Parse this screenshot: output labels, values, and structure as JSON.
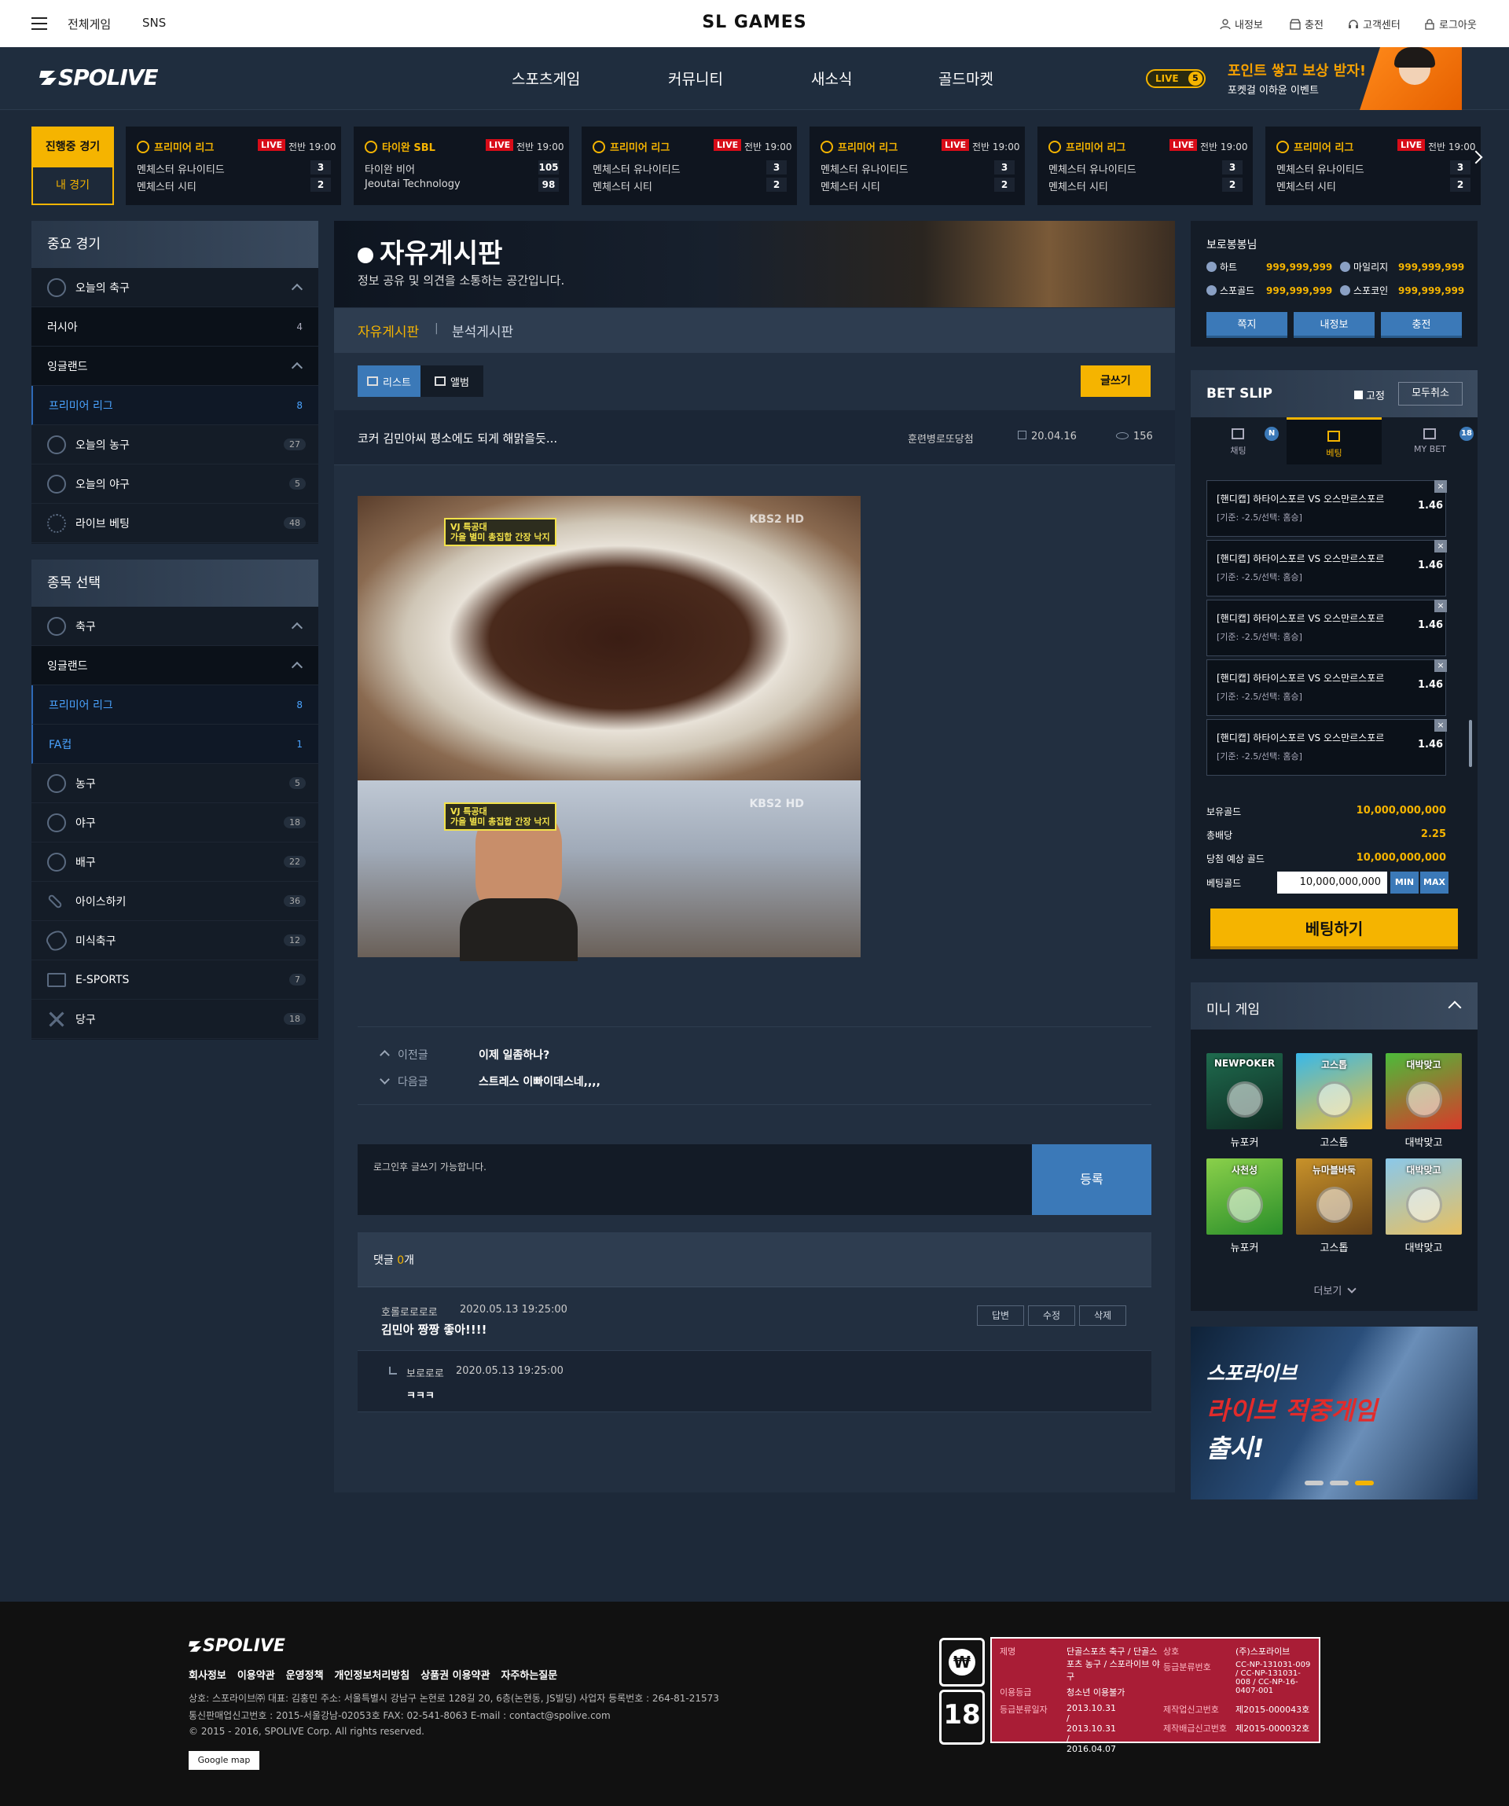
{
  "topbar": {
    "menu_all": "전체게임",
    "menu_sns": "SNS",
    "logo": "SL GAMES",
    "myinfo": "내정보",
    "charge": "충전",
    "support": "고객센터",
    "logout": "로그아웃"
  },
  "nav": {
    "brand": "SPOLIVE",
    "items": [
      "스포츠게임",
      "커뮤니티",
      "새소식",
      "골드마켓"
    ],
    "live_badge": "LIVE",
    "live_count": "5",
    "promo_title": "포인트 쌓고 보상 받자!",
    "promo_sub": "포켓걸 이하윤 이벤트"
  },
  "matches": {
    "tab_live": "진행중 경기",
    "tab_mine": "내 경기",
    "cards": [
      {
        "league": "프리미어 리그",
        "live": "LIVE",
        "time": "전반 19:00",
        "team1": "멘체스터 유나이티드",
        "team2": "멘체스터 시티",
        "score1": "3",
        "score2": "2"
      },
      {
        "league": "타이완 SBL",
        "live": "LIVE",
        "time": "전반 19:00",
        "team1": "타이완 비어",
        "team2": "Jeoutai Technology",
        "score1": "105",
        "score2": "98"
      },
      {
        "league": "프리미어 리그",
        "live": "LIVE",
        "time": "전반 19:00",
        "team1": "멘체스터 유나이티드",
        "team2": "멘체스터 시티",
        "score1": "3",
        "score2": "2"
      },
      {
        "league": "프리미어 리그",
        "live": "LIVE",
        "time": "전반 19:00",
        "team1": "멘체스터 유나이티드",
        "team2": "멘체스터 시티",
        "score1": "3",
        "score2": "2"
      },
      {
        "league": "프리미어 리그",
        "live": "LIVE",
        "time": "전반 19:00",
        "team1": "멘체스터 유나이티드",
        "team2": "멘체스터 시티",
        "score1": "3",
        "score2": "2"
      },
      {
        "league": "프리미어 리그",
        "live": "LIVE",
        "time": "전반 19:00",
        "team1": "멘체스터 유나이티드",
        "team2": "멘체스터 시티",
        "score1": "3",
        "score2": "2"
      }
    ]
  },
  "important": {
    "title": "중요 경기",
    "rows": [
      {
        "label": "오늘의 축구",
        "count": ""
      },
      {
        "label": "러시아",
        "count": "4"
      },
      {
        "label": "잉글랜드",
        "count": ""
      },
      {
        "label": "프리미어 리그",
        "count": "8"
      },
      {
        "label": "오늘의 농구",
        "count": "27"
      },
      {
        "label": "오늘의 야구",
        "count": "5"
      },
      {
        "label": "라이브 베팅",
        "count": "48"
      }
    ]
  },
  "sports": {
    "title": "종목 선택",
    "rows": [
      {
        "label": "축구",
        "count": ""
      },
      {
        "label": "잉글랜드",
        "count": ""
      },
      {
        "label": "프리미어 리그",
        "count": "8"
      },
      {
        "label": "FA컵",
        "count": "1"
      },
      {
        "label": "농구",
        "count": "5"
      },
      {
        "label": "야구",
        "count": "18"
      },
      {
        "label": "배구",
        "count": "22"
      },
      {
        "label": "아이스하키",
        "count": "36"
      },
      {
        "label": "미식축구",
        "count": "12"
      },
      {
        "label": "E-SPORTS",
        "count": "7"
      },
      {
        "label": "당구",
        "count": "18"
      }
    ]
  },
  "board": {
    "title": "자유게시판",
    "subtitle": "정보 공유 및 의견을 소통하는 공간입니다.",
    "tab_free": "자유게시판",
    "tab_analysis": "분석게시판",
    "view_list": "리스트",
    "view_album": "앨범",
    "write": "글쓰기",
    "post": {
      "title": "코커 김민아씨 평소에도 되게 해맑을듯...",
      "author": "훈련병로또당첨",
      "date": "20.04.16",
      "views": "156"
    },
    "image_caption1": "VJ 특공대",
    "image_caption2": "가을 별미 총집합 간장 낙지",
    "watermark": "KBS2 HD",
    "prev_label": "이전글",
    "prev_title": "이제 일좀하나?",
    "next_label": "다음글",
    "next_title": "스트레스 이빠이데스네,,,,",
    "comment_placeholder": "로그인후 글쓰기 가능합니다.",
    "register": "등록",
    "comments_label": "댓글",
    "comments_count": "0",
    "comments_unit": "개",
    "comment": {
      "author": "호롤로로로로",
      "date": "2020.05.13  19:25:00",
      "text": "김민아 짱짱 좋아!!!!",
      "reply_btn": "답변",
      "edit_btn": "수정",
      "delete_btn": "삭제"
    },
    "reply": {
      "author": "보로로로",
      "date": "2020.05.13  19:25:00",
      "text": "ㅋㅋㅋ"
    }
  },
  "user": {
    "name": "보로봉봉님",
    "heart_label": "하트",
    "heart": "999,999,999",
    "mileage_label": "마일리지",
    "mileage": "999,999,999",
    "gold_label": "스포골드",
    "gold": "999,999,999",
    "coin_label": "스포코인",
    "coin": "999,999,999",
    "btn_note": "쪽지",
    "btn_info": "내정보",
    "btn_charge": "충전"
  },
  "betslip": {
    "title": "BET SLIP",
    "fix": "고정",
    "cancel_all": "모두취소",
    "tab_chat": "채팅",
    "tab_chat_badge": "N",
    "tab_bet": "베팅",
    "tab_mybet": "MY BET",
    "tab_mybet_badge": "18",
    "items": [
      {
        "name": "[핸디캡] 하타이스포르 VS 오스만르스포르",
        "sub": "[기준: -2.5/선택: 홈승]",
        "odds": "1.46"
      },
      {
        "name": "[핸디캡] 하타이스포르 VS 오스만르스포르",
        "sub": "[기준: -2.5/선택: 홈승]",
        "odds": "1.46"
      },
      {
        "name": "[핸디캡] 하타이스포르 VS 오스만르스포르",
        "sub": "[기준: -2.5/선택: 홈승]",
        "odds": "1.46"
      },
      {
        "name": "[핸디캡] 하타이스포르 VS 오스만르스포르",
        "sub": "[기준: -2.5/선택: 홈승]",
        "odds": "1.46"
      },
      {
        "name": "[핸디캡] 하타이스포르 VS 오스만르스포르",
        "sub": "[기준: -2.5/선택: 홈승]",
        "odds": "1.46"
      }
    ],
    "held_label": "보유골드",
    "held": "10,000,000,000",
    "total_odds_label": "총배당",
    "total_odds": "2.25",
    "expected_label": "당첨 예상 골드",
    "expected": "10,000,000,000",
    "bet_label": "베팅골드",
    "bet_value": "10,000,000,000",
    "min": "MIN",
    "max": "MAX",
    "bet_button": "베팅하기"
  },
  "minigame": {
    "title": "미니 게임",
    "games": [
      {
        "label": "뉴포커",
        "logo": "NEWPOKER",
        "color1": "#1f6b4e",
        "color2": "#0e2a22"
      },
      {
        "label": "고스톱",
        "logo": "고스톱",
        "color1": "#38b8ea",
        "color2": "#f3c032"
      },
      {
        "label": "대박맞고",
        "logo": "대박맞고",
        "color1": "#4cbb3a",
        "color2": "#d93a2a"
      },
      {
        "label": "뉴포커",
        "logo": "사천성",
        "color1": "#8ad04a",
        "color2": "#2a8e2a"
      },
      {
        "label": "고스톱",
        "logo": "뉴마블바둑",
        "color1": "#c8922a",
        "color2": "#6a4418"
      },
      {
        "label": "대박맞고",
        "logo": "대박맞고",
        "color1": "#8ac8ea",
        "color2": "#e8c060"
      }
    ],
    "more": "더보기"
  },
  "ad": {
    "line1": "스포라이브",
    "line2": "라이브 적중게임",
    "line3": "출시!"
  },
  "footer": {
    "brand": "SPOLIVE",
    "links": [
      "회사정보",
      "이용약관",
      "운영정책",
      "개인정보처리방침",
      "상품권 이용약관",
      "자주하는질문"
    ],
    "info1": "상호: 스포라이브㈜   대표: 김홍민   주소: 서울특별시 강남구 논현로 128길 20, 6층(논현동, JS빌딩)   사업자 등록번호 : 264-81-21573",
    "info2": "통신판매업신고번호 : 2015-서울강남-02053호    FAX: 02-541-8063    E-mail : contact@spolive.com",
    "info3": "© 2015 - 2016, SPOLIVE Corp. All rights reserved.",
    "gmap": "Google map",
    "rating": {
      "k_title": "제명",
      "v_title": "단골스포츠 축구 / 단골스포츠 농구 / 스포라이브 야구",
      "k_grade": "이용등급",
      "v_grade": "청소년 이용불가",
      "k_date": "등급분류일자",
      "v_date": "2013.10.31 / 2013.10.31 / 2016.04.07",
      "k_co": "상호",
      "v_co": "(주)스포라이브",
      "k_no": "등급분류번호",
      "v_no": "CC-NP-131031-009 / CC-NP-131031-008 / CC-NP-16-0407-001",
      "k_mfg": "제작업신고번호",
      "v_mfg": "제2015-000043호",
      "k_dist": "제작배급신고번호",
      "v_dist": "제2015-000032호"
    },
    "age_label": "18"
  }
}
